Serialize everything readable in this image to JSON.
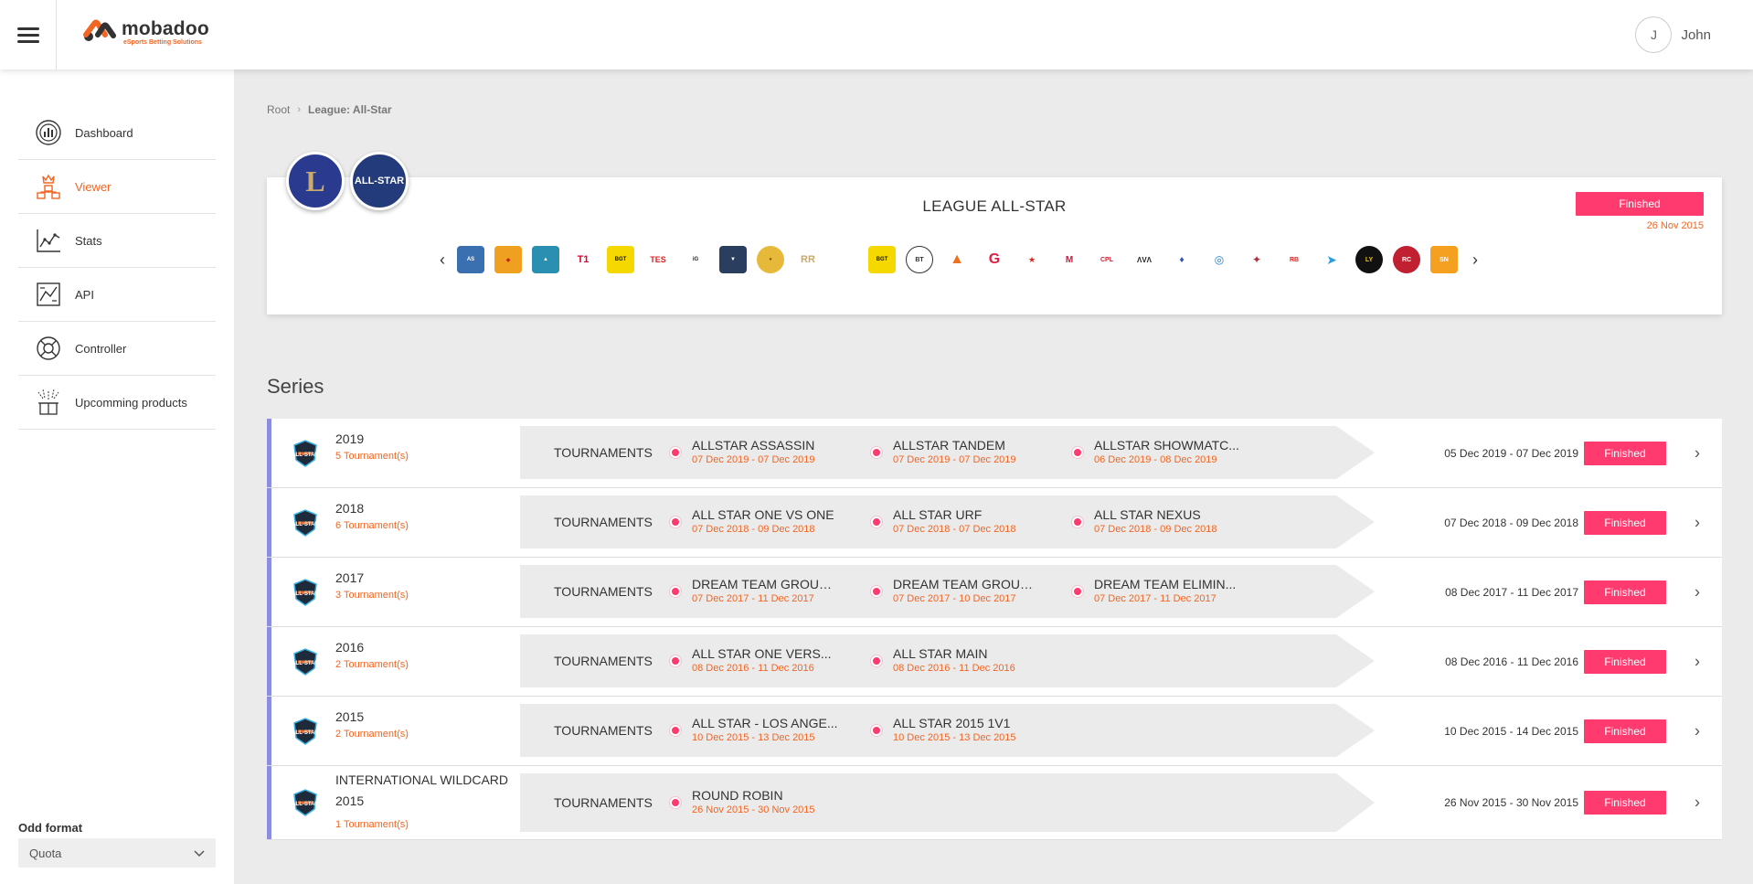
{
  "header": {
    "brand_name": "mobadoo",
    "brand_tagline": "eSports Betting Solutions",
    "user_initial": "J",
    "user_name": "John"
  },
  "sidebar": {
    "items": [
      {
        "label": "Dashboard",
        "icon": "dashboard-icon",
        "active": false
      },
      {
        "label": "Viewer",
        "icon": "viewer-icon",
        "active": true
      },
      {
        "label": "Stats",
        "icon": "stats-icon",
        "active": false
      },
      {
        "label": "API",
        "icon": "api-icon",
        "active": false
      },
      {
        "label": "Controller",
        "icon": "controller-icon",
        "active": false
      },
      {
        "label": "Upcomming products",
        "icon": "products-icon",
        "active": false
      }
    ],
    "odd_format_label": "Odd format",
    "odd_format_value": "Quota"
  },
  "breadcrumb": {
    "root": "Root",
    "current": "League: All-Star"
  },
  "league": {
    "icon_lol": "L",
    "icon_allstar": "ALL-STAR",
    "title": "LEAGUE ALL-STAR",
    "status": "Finished",
    "date": "26 Nov 2015"
  },
  "series_heading": "Series",
  "band_label": "TOURNAMENTS",
  "series": [
    {
      "name": "2019",
      "count": "5 Tournament(s)",
      "range": "05 Dec 2019 - 07 Dec 2019",
      "status": "Finished",
      "tournaments": [
        {
          "name": "ALLSTAR ASSASSIN",
          "date": "07 Dec 2019 - 07 Dec 2019"
        },
        {
          "name": "ALLSTAR TANDEM",
          "date": "07 Dec 2019 - 07 Dec 2019"
        },
        {
          "name": "ALLSTAR SHOWMATC...",
          "date": "06 Dec 2019 - 08 Dec 2019"
        }
      ]
    },
    {
      "name": "2018",
      "count": "6 Tournament(s)",
      "range": "07 Dec 2018 - 09 Dec 2018",
      "status": "Finished",
      "tournaments": [
        {
          "name": "ALL STAR ONE VS ONE",
          "date": "07 Dec 2018 - 09 Dec 2018"
        },
        {
          "name": "ALL STAR URF",
          "date": "07 Dec 2018 - 07 Dec 2018"
        },
        {
          "name": "ALL STAR NEXUS",
          "date": "07 Dec 2018 - 09 Dec 2018"
        }
      ]
    },
    {
      "name": "2017",
      "count": "3 Tournament(s)",
      "range": "08 Dec 2017 - 11 Dec 2017",
      "status": "Finished",
      "tournaments": [
        {
          "name": "DREAM TEAM GROUP A",
          "date": "07 Dec 2017 - 11 Dec 2017"
        },
        {
          "name": "DREAM TEAM GROUP B",
          "date": "07 Dec 2017 - 10 Dec 2017"
        },
        {
          "name": "DREAM TEAM ELIMIN...",
          "date": "07 Dec 2017 - 11 Dec 2017"
        }
      ]
    },
    {
      "name": "2016",
      "count": "2 Tournament(s)",
      "range": "08 Dec 2016 - 11 Dec 2016",
      "status": "Finished",
      "tournaments": [
        {
          "name": "ALL STAR ONE VERS...",
          "date": "08 Dec 2016 - 11 Dec 2016"
        },
        {
          "name": "ALL STAR MAIN",
          "date": "08 Dec 2016 - 11 Dec 2016"
        }
      ]
    },
    {
      "name": "2015",
      "count": "2 Tournament(s)",
      "range": "10 Dec 2015 - 14 Dec 2015",
      "status": "Finished",
      "tournaments": [
        {
          "name": "ALL STAR - LOS ANGE...",
          "date": "10 Dec 2015 - 13 Dec 2015"
        },
        {
          "name": "ALL STAR 2015 1V1",
          "date": "10 Dec 2015 - 13 Dec 2015"
        }
      ]
    },
    {
      "name": "INTERNATIONAL WILDCARD 2015",
      "count": "1 Tournament(s)",
      "range": "26 Nov 2015 - 30 Nov 2015",
      "status": "Finished",
      "tournaments": [
        {
          "name": "ROUND ROBIN",
          "date": "26 Nov 2015 - 30 Nov 2015"
        }
      ]
    }
  ],
  "colors": {
    "accent": "#f26522",
    "status": "#ff3a6e",
    "row_border": "#8c8ce0"
  }
}
